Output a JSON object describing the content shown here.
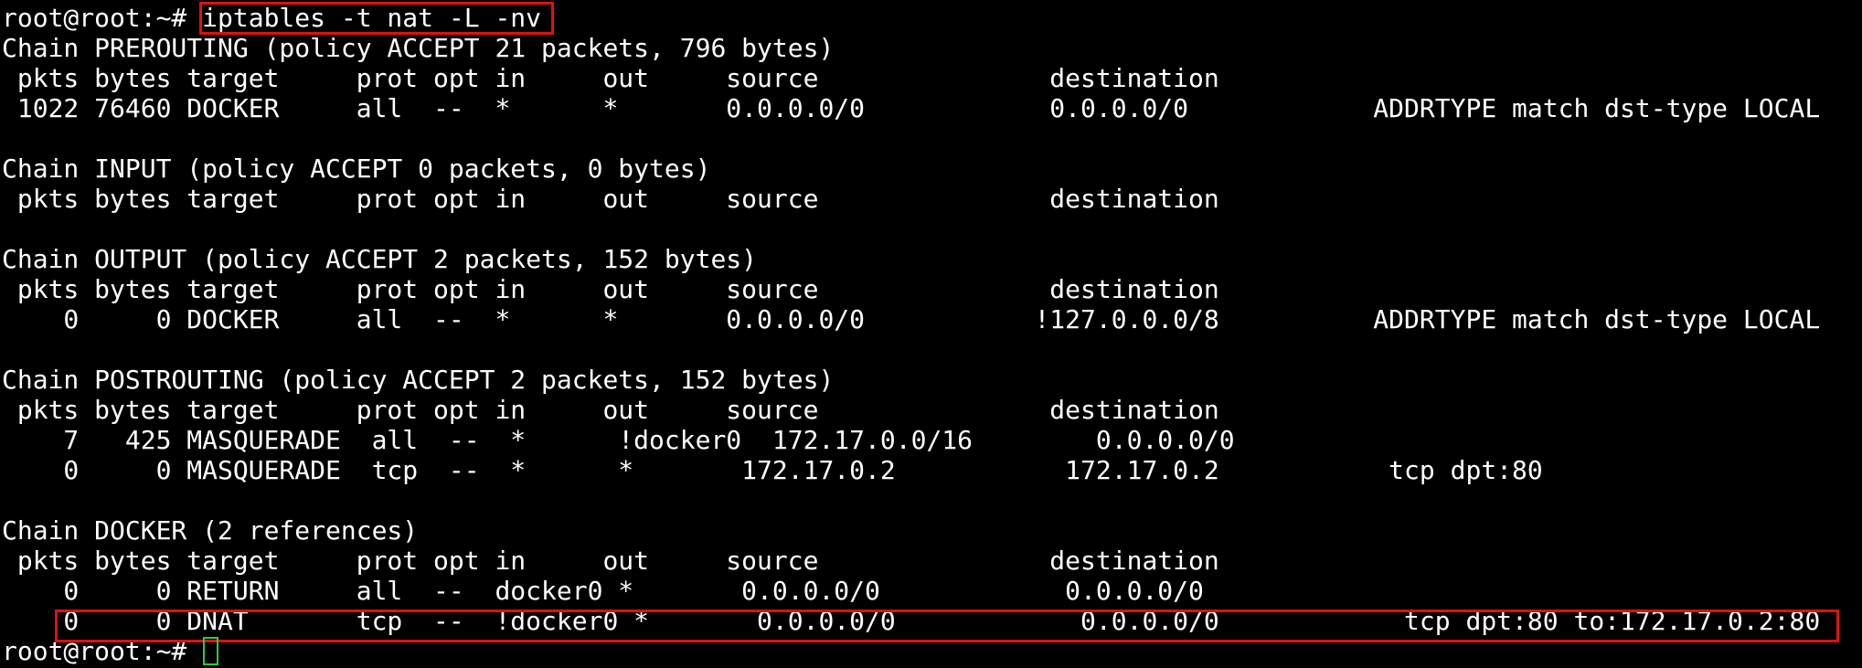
{
  "terminal": {
    "lines": [
      "root@root:~# iptables -t nat -L -nv",
      "Chain PREROUTING (policy ACCEPT 21 packets, 796 bytes)",
      " pkts bytes target     prot opt in     out     source               destination",
      " 1022 76460 DOCKER     all  --  *      *       0.0.0.0/0            0.0.0.0/0            ADDRTYPE match dst-type LOCAL",
      "",
      "Chain INPUT (policy ACCEPT 0 packets, 0 bytes)",
      " pkts bytes target     prot opt in     out     source               destination",
      "",
      "Chain OUTPUT (policy ACCEPT 2 packets, 152 bytes)",
      " pkts bytes target     prot opt in     out     source               destination",
      "    0     0 DOCKER     all  --  *      *       0.0.0.0/0           !127.0.0.0/8          ADDRTYPE match dst-type LOCAL",
      "",
      "Chain POSTROUTING (policy ACCEPT 2 packets, 152 bytes)",
      " pkts bytes target     prot opt in     out     source               destination",
      "    7   425 MASQUERADE  all  --  *      !docker0  172.17.0.0/16        0.0.0.0/0",
      "    0     0 MASQUERADE  tcp  --  *      *       172.17.0.2           172.17.0.2           tcp dpt:80",
      "",
      "Chain DOCKER (2 references)",
      " pkts bytes target     prot opt in     out     source               destination",
      "    0     0 RETURN     all  --  docker0 *       0.0.0.0/0            0.0.0.0/0",
      "    0     0 DNAT       tcp  --  !docker0 *       0.0.0.0/0            0.0.0.0/0            tcp dpt:80 to:172.17.0.2:80",
      "root@root:~# "
    ],
    "colors": {
      "background": "#000000",
      "text": "#ffffff",
      "highlight": "#e01010",
      "cursor": "#2ecc40"
    }
  }
}
